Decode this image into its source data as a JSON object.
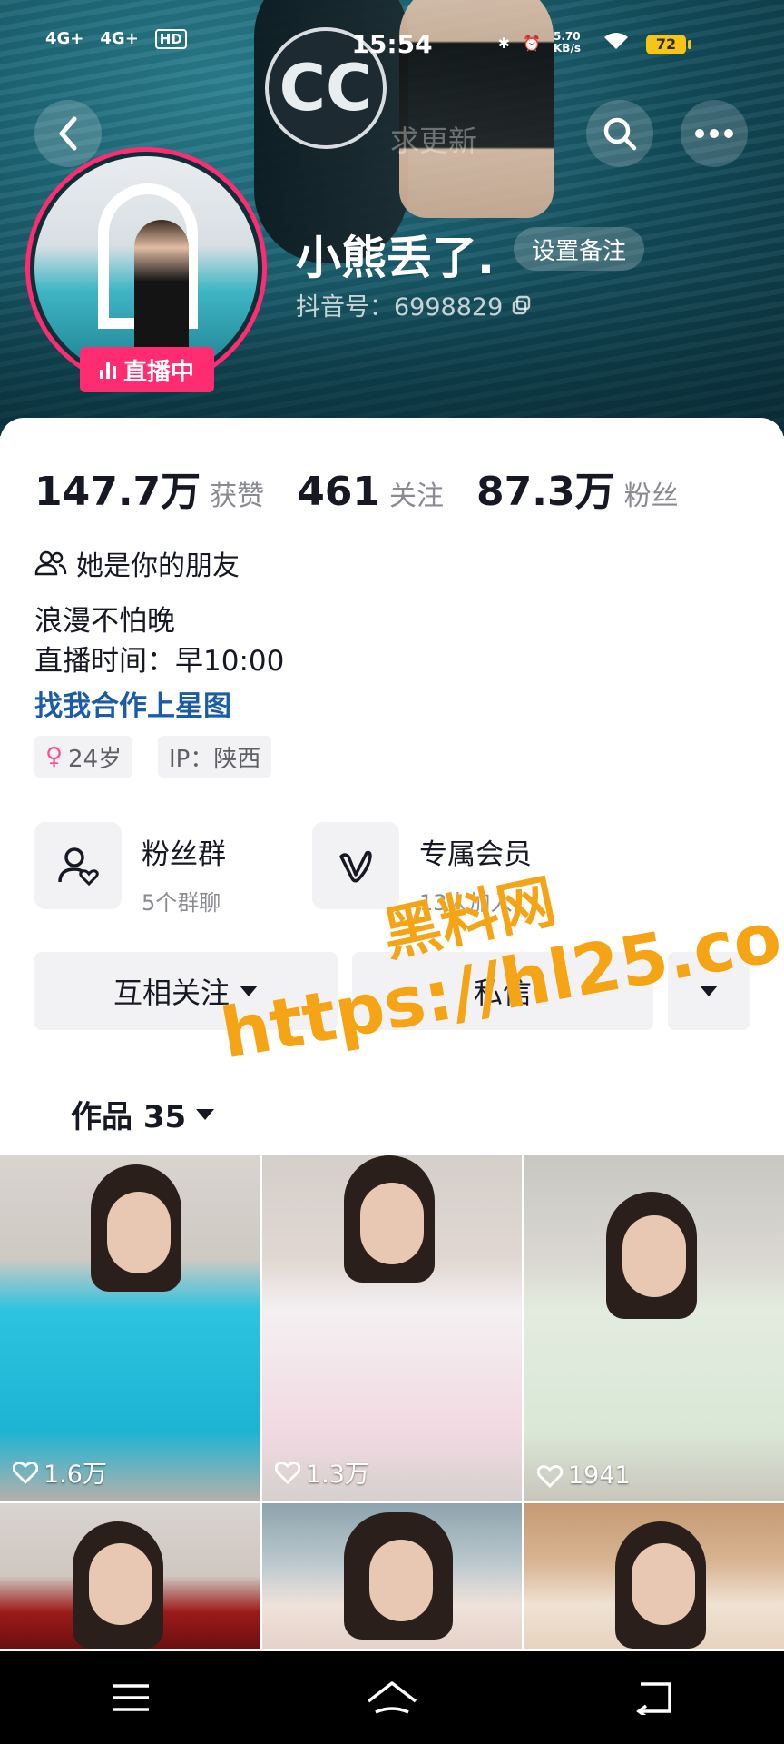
{
  "status_bar": {
    "signal1": "4G+",
    "signal2": "4G+",
    "hd": "HD",
    "time": "15:54",
    "net_speed": "5.70 KB/s",
    "battery": "72"
  },
  "cover": {
    "watermark_text": "求更新"
  },
  "profile": {
    "username": "小熊丢了.",
    "remark_button": "设置备注",
    "douyin_id": "抖音号：6998829",
    "live_badge": "直播中"
  },
  "stats": [
    {
      "value": "147.7万",
      "label": "获赞"
    },
    {
      "value": "461",
      "label": "关注"
    },
    {
      "value": "87.3万",
      "label": "粉丝"
    }
  ],
  "relation": "她是你的朋友",
  "bio": {
    "line1": "浪漫不怕晚",
    "line2": "直播时间：早10:00",
    "link": "找我合作上星图"
  },
  "tags": {
    "age": "24岁",
    "ip": "IP：陕西"
  },
  "features": {
    "fans_group": {
      "title": "粉丝群",
      "subtitle": "5个群聊"
    },
    "membership": {
      "title": "专属会员",
      "subtitle": "13人加入"
    }
  },
  "actions": {
    "follow": "互相关注",
    "message": "私信"
  },
  "works": {
    "tab_label": "作品 35"
  },
  "videos": [
    {
      "likes": "1.6万"
    },
    {
      "likes": "1.3万"
    },
    {
      "likes": "1941"
    },
    {
      "likes": ""
    },
    {
      "likes": ""
    },
    {
      "likes": ""
    }
  ],
  "watermark": {
    "cn": "黑料网",
    "url": "https://hl25.co"
  },
  "colors": {
    "accent_pink": "#ff2c72",
    "link_blue": "#1a5ca8",
    "watermark_orange": "#f5a416"
  }
}
